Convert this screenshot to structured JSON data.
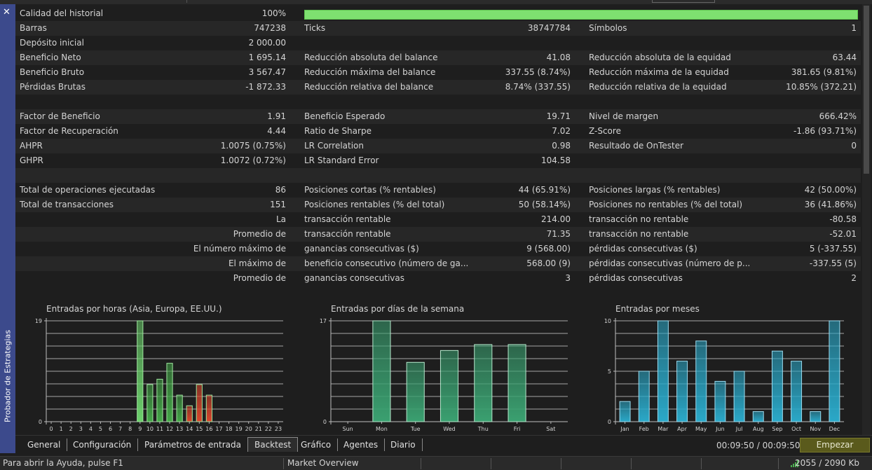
{
  "window": {
    "side_title": "Probador de Estrategias",
    "close_glyph": "✕"
  },
  "stats": {
    "quality": {
      "label": "Calidad del historial",
      "value": "100%",
      "fraction": 1.0
    },
    "rows": [
      {
        "c1": [
          "Barras",
          "747238"
        ],
        "c2": [
          "Ticks",
          "38747784"
        ],
        "c3": [
          "Símbolos",
          "1"
        ]
      },
      {
        "c1": [
          "Depósito inicial",
          "2 000.00"
        ],
        "c2": [
          "",
          ""
        ],
        "c3": [
          "",
          ""
        ]
      },
      {
        "c1": [
          "Beneficio Neto",
          "1 695.14"
        ],
        "c2": [
          "Reducción absoluta del balance",
          "41.08"
        ],
        "c3": [
          "Reducción absoluta de la equidad",
          "63.44"
        ]
      },
      {
        "c1": [
          "Beneficio Bruto",
          "3 567.47"
        ],
        "c2": [
          "Reducción máxima del balance",
          "337.55 (8.74%)"
        ],
        "c3": [
          "Reducción máxima de la equidad",
          "381.65 (9.81%)"
        ]
      },
      {
        "c1": [
          "Pérdidas Brutas",
          "-1 872.33"
        ],
        "c2": [
          "Reducción relativa del balance",
          "8.74% (337.55)"
        ],
        "c3": [
          "Reducción relativa de la equidad",
          "10.85% (372.21)"
        ]
      },
      {
        "c1": [
          "",
          ""
        ],
        "c2": [
          "",
          ""
        ],
        "c3": [
          "",
          ""
        ]
      },
      {
        "c1": [
          "Factor de Beneficio",
          "1.91"
        ],
        "c2": [
          "Beneficio Esperado",
          "19.71"
        ],
        "c3": [
          "Nivel de margen",
          "666.42%"
        ]
      },
      {
        "c1": [
          "Factor de Recuperación",
          "4.44"
        ],
        "c2": [
          "Ratio de Sharpe",
          "7.02"
        ],
        "c3": [
          "Z-Score",
          "-1.86 (93.71%)"
        ]
      },
      {
        "c1": [
          "AHPR",
          "1.0075 (0.75%)"
        ],
        "c2": [
          "LR Correlation",
          "0.98"
        ],
        "c3": [
          "Resultado de OnTester",
          "0"
        ]
      },
      {
        "c1": [
          "GHPR",
          "1.0072 (0.72%)"
        ],
        "c2": [
          "LR Standard Error",
          "104.58"
        ],
        "c3": [
          "",
          ""
        ]
      },
      {
        "c1": [
          "",
          ""
        ],
        "c2": [
          "",
          ""
        ],
        "c3": [
          "",
          ""
        ]
      },
      {
        "c1": [
          "Total de operaciones ejecutadas",
          "86"
        ],
        "c2": [
          "Posiciones cortas (% rentables)",
          "44 (65.91%)"
        ],
        "c3": [
          "Posiciones largas (% rentables)",
          "42 (50.00%)"
        ]
      },
      {
        "c1": [
          "Total de transacciones",
          "151"
        ],
        "c2": [
          "Posiciones rentables (% del total)",
          "50 (58.14%)"
        ],
        "c3": [
          "Posiciones no rentables (% del total)",
          "36 (41.86%)"
        ]
      },
      {
        "c1": [
          "",
          "La"
        ],
        "c2": [
          "transacción rentable",
          "214.00"
        ],
        "c3": [
          "transacción no rentable",
          "-80.58"
        ]
      },
      {
        "c1": [
          "",
          "Promedio de"
        ],
        "c2": [
          "transacción rentable",
          "71.35"
        ],
        "c3": [
          "transacción no rentable",
          "-52.01"
        ]
      },
      {
        "c1": [
          "",
          "El número máximo de"
        ],
        "c2": [
          "ganancias consecutivas ($)",
          "9 (568.00)"
        ],
        "c3": [
          "pérdidas consecutivas ($)",
          "5 (-337.55)"
        ]
      },
      {
        "c1": [
          "",
          "El máximo de"
        ],
        "c2": [
          "beneficio consecutivo (número de ga...",
          "568.00 (9)"
        ],
        "c3": [
          "pérdidas consecutivas (número de p...",
          "-337.55 (5)"
        ]
      },
      {
        "c1": [
          "",
          "Promedio de"
        ],
        "c2": [
          "ganancias consecutivas",
          "3"
        ],
        "c3": [
          "pérdidas consecutivas",
          "2"
        ]
      }
    ]
  },
  "chart_data": [
    {
      "type": "bar",
      "title": "Entradas por horas (Asia, Europa, EE.UU.)",
      "categories": [
        "0",
        "1",
        "2",
        "3",
        "4",
        "5",
        "6",
        "7",
        "8",
        "9",
        "10",
        "11",
        "12",
        "13",
        "14",
        "15",
        "16",
        "17",
        "18",
        "19",
        "20",
        "21",
        "22",
        "23"
      ],
      "ylim": [
        0,
        19
      ],
      "y_ticks": [
        "0",
        "19"
      ],
      "series": [
        {
          "values": [
            0,
            0,
            0,
            0,
            0,
            0,
            0,
            0,
            0,
            19,
            7,
            8,
            11,
            5,
            3,
            7,
            5,
            0,
            0,
            0,
            0,
            0,
            0,
            0
          ]
        }
      ],
      "bar_colors": [
        "#4caf50",
        "#4caf50",
        "#4caf50",
        "#4caf50",
        "#4caf50",
        "#4caf50",
        "#4caf50",
        "#4caf50",
        "#4caf50",
        "#6bd06b",
        "#43a547",
        "#43a547",
        "#43a547",
        "#43a547",
        "#d9452c",
        "#d9452c",
        "#d9452c",
        "#4caf50",
        "#4caf50",
        "#4caf50",
        "#4caf50",
        "#4caf50",
        "#4caf50",
        "#4caf50"
      ],
      "grid": true
    },
    {
      "type": "bar",
      "title": "Entradas por días de la semana",
      "categories": [
        "Sun",
        "Mon",
        "Tue",
        "Wed",
        "Thu",
        "Fri",
        "Sat"
      ],
      "ylim": [
        0,
        17
      ],
      "y_ticks": [
        "0",
        "17"
      ],
      "series": [
        {
          "values": [
            0,
            17,
            10,
            12,
            13,
            13,
            0
          ]
        }
      ],
      "bar_color": "#3aa070",
      "grid": true
    },
    {
      "type": "bar",
      "title": "Entradas por meses",
      "categories": [
        "Jan",
        "Feb",
        "Mar",
        "Apr",
        "May",
        "Jun",
        "Jul",
        "Aug",
        "Sep",
        "Oct",
        "Nov",
        "Dec"
      ],
      "ylim": [
        0,
        10
      ],
      "y_ticks": [
        "0",
        "5",
        "10"
      ],
      "series": [
        {
          "values": [
            2,
            5,
            10,
            6,
            8,
            4,
            5,
            1,
            7,
            6,
            1,
            10
          ]
        }
      ],
      "bar_color": "#2aa8c8",
      "grid": true
    }
  ],
  "tabs": [
    "General",
    "Configuración",
    "Parámetros de entrada",
    "Backtest",
    "Gráfico",
    "Agentes",
    "Diario"
  ],
  "active_tab": "Backtest",
  "timer": "00:09:50 / 00:09:50",
  "start_button": "Empezar",
  "statusbar": {
    "help": "Para abrir la Ayuda, pulse F1",
    "market": "Market Overview",
    "memory": "2055 / 2090 Kb"
  },
  "colors": {
    "accent_sidebar": "#3c4a8c",
    "quality_bar": "#7ee070",
    "start_button": "#5a5a1c"
  }
}
